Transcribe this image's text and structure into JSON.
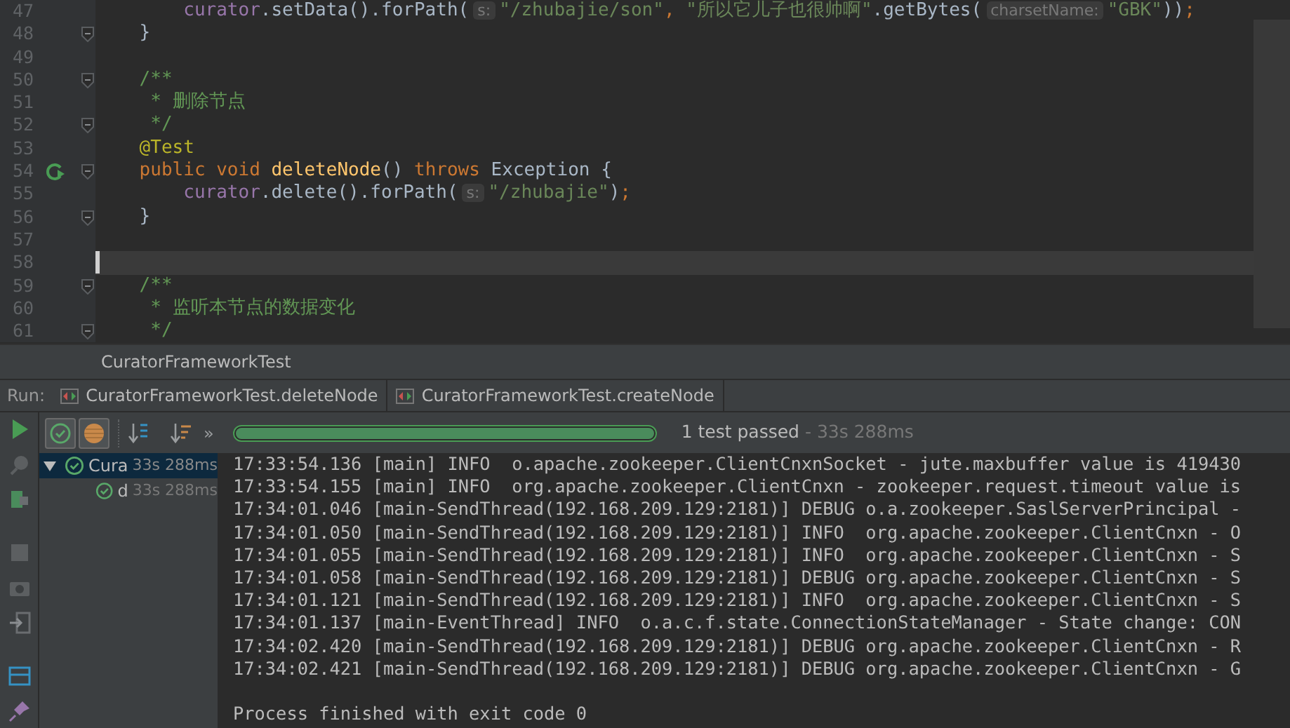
{
  "editor": {
    "lines": [
      {
        "number": "47",
        "fold": false,
        "run_icon": false,
        "current": false,
        "tokens": [
          {
            "kind": "field",
            "text": "        curator"
          },
          {
            "kind": "plain",
            "text": ".setData().forPath("
          },
          {
            "kind": "hint",
            "text": "s:"
          },
          {
            "kind": "str",
            "text": "\"/zhubajie/son\""
          },
          {
            "kind": "kw",
            "text": ", "
          },
          {
            "kind": "str",
            "text": "\"所以它儿子也很帅啊\""
          },
          {
            "kind": "plain",
            "text": ".getBytes("
          },
          {
            "kind": "hint",
            "text": "charsetName:"
          },
          {
            "kind": "str",
            "text": "\"GBK\""
          },
          {
            "kind": "plain",
            "text": "))"
          },
          {
            "kind": "kw",
            "text": ";"
          }
        ]
      },
      {
        "number": "48",
        "fold": true,
        "run_icon": false,
        "current": false,
        "tokens": [
          {
            "kind": "plain",
            "text": "    }"
          }
        ]
      },
      {
        "number": "49",
        "fold": false,
        "run_icon": false,
        "current": false
      },
      {
        "number": "50",
        "fold": true,
        "run_icon": false,
        "current": false,
        "tokens": [
          {
            "kind": "comment",
            "text": "    /**"
          }
        ]
      },
      {
        "number": "51",
        "fold": false,
        "run_icon": false,
        "current": false,
        "tokens": [
          {
            "kind": "comment",
            "text": "     * 删除节点"
          }
        ]
      },
      {
        "number": "52",
        "fold": true,
        "run_icon": false,
        "current": false,
        "tokens": [
          {
            "kind": "comment",
            "text": "     */"
          }
        ]
      },
      {
        "number": "53",
        "fold": false,
        "run_icon": false,
        "current": false,
        "tokens": [
          {
            "kind": "annotation",
            "text": "    @Test"
          }
        ]
      },
      {
        "number": "54",
        "fold": true,
        "run_icon": true,
        "current": false,
        "tokens": [
          {
            "kind": "kw",
            "text": "    public void "
          },
          {
            "kind": "fn",
            "text": "deleteNode"
          },
          {
            "kind": "plain",
            "text": "() "
          },
          {
            "kind": "kw",
            "text": "throws "
          },
          {
            "kind": "plain",
            "text": "Exception {"
          }
        ]
      },
      {
        "number": "55",
        "fold": false,
        "run_icon": false,
        "current": false,
        "tokens": [
          {
            "kind": "field",
            "text": "        curator"
          },
          {
            "kind": "plain",
            "text": ".delete().forPath("
          },
          {
            "kind": "hint",
            "text": "s:"
          },
          {
            "kind": "str",
            "text": "\"/zhubajie\""
          },
          {
            "kind": "plain",
            "text": ")"
          },
          {
            "kind": "kw",
            "text": ";"
          }
        ]
      },
      {
        "number": "56",
        "fold": true,
        "run_icon": false,
        "current": false,
        "tokens": [
          {
            "kind": "plain",
            "text": "    }"
          }
        ]
      },
      {
        "number": "57",
        "fold": false,
        "run_icon": false,
        "current": false
      },
      {
        "number": "58",
        "fold": false,
        "run_icon": false,
        "current": true
      },
      {
        "number": "59",
        "fold": true,
        "run_icon": false,
        "current": false,
        "tokens": [
          {
            "kind": "comment",
            "text": "    /**"
          }
        ]
      },
      {
        "number": "60",
        "fold": false,
        "run_icon": false,
        "current": false,
        "tokens": [
          {
            "kind": "comment",
            "text": "     * 监听本节点的数据变化"
          }
        ]
      },
      {
        "number": "61",
        "fold": true,
        "run_icon": false,
        "current": false,
        "tokens": [
          {
            "kind": "comment",
            "text": "     */"
          }
        ]
      }
    ]
  },
  "breadcrumb": "CuratorFrameworkTest",
  "run": {
    "label": "Run:",
    "tabs": [
      "CuratorFrameworkTest.deleteNode",
      "CuratorFrameworkTest.createNode"
    ]
  },
  "toolbar": {
    "toggles": [
      {
        "kind": "passed",
        "selected": true
      },
      {
        "kind": "ignored",
        "selected": true
      }
    ],
    "more": "»",
    "progress": {
      "level": 1
    },
    "status": "1 test passed",
    "duration": " - 33s 288ms"
  },
  "tree": [
    {
      "label": "Cura",
      "time": "33s 288ms",
      "selected": true,
      "expanded": true,
      "children": [
        {
          "label": "d",
          "time": "33s 288ms",
          "selected": false
        }
      ]
    }
  ],
  "console": {
    "lines": [
      "17:33:54.136 [main] INFO  o.apache.zookeeper.ClientCnxnSocket - jute.maxbuffer value is 419430",
      "17:33:54.155 [main] INFO  org.apache.zookeeper.ClientCnxn - zookeeper.request.timeout value is",
      "17:34:01.046 [main-SendThread(192.168.209.129:2181)] DEBUG o.a.zookeeper.SaslServerPrincipal -",
      "17:34:01.050 [main-SendThread(192.168.209.129:2181)] INFO  org.apache.zookeeper.ClientCnxn - O",
      "17:34:01.055 [main-SendThread(192.168.209.129:2181)] INFO  org.apache.zookeeper.ClientCnxn - S",
      "17:34:01.058 [main-SendThread(192.168.209.129:2181)] DEBUG org.apache.zookeeper.ClientCnxn - S",
      "17:34:01.121 [main-SendThread(192.168.209.129:2181)] INFO  org.apache.zookeeper.ClientCnxn - S",
      "17:34:01.137 [main-EventThread] INFO  o.a.c.f.state.ConnectionStateManager - State change: CON",
      "17:34:02.420 [main-SendThread(192.168.209.129:2181)] DEBUG org.apache.zookeeper.ClientCnxn - R",
      "17:34:02.421 [main-SendThread(192.168.209.129:2181)] DEBUG org.apache.zookeeper.ClientCnxn - G"
    ],
    "exit": "Process finished with exit code 0"
  }
}
